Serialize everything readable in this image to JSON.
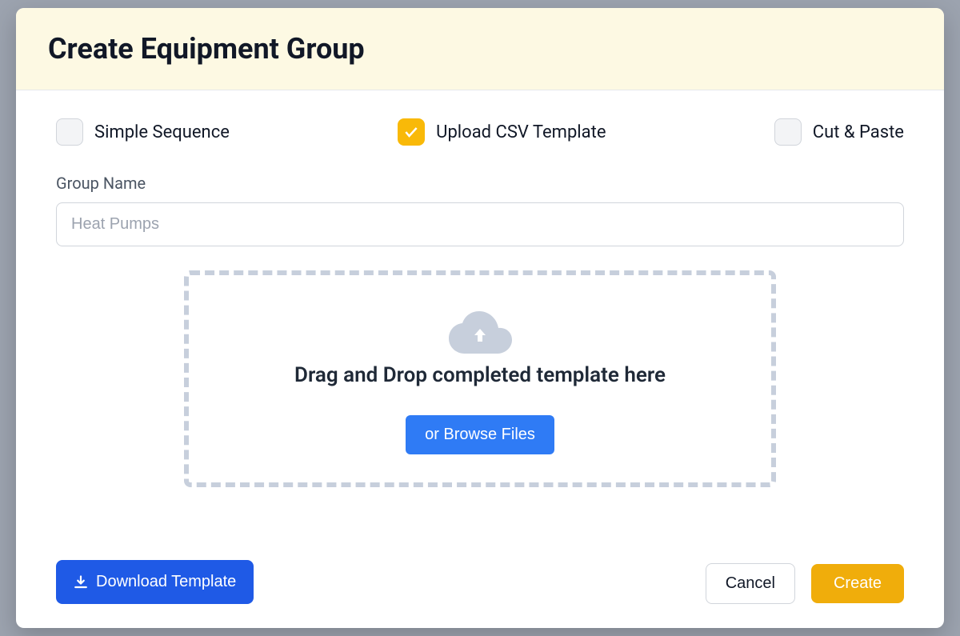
{
  "modal": {
    "title": "Create Equipment Group"
  },
  "options": {
    "simple_sequence": {
      "label": "Simple Sequence",
      "checked": false
    },
    "upload_csv": {
      "label": "Upload CSV Template",
      "checked": true
    },
    "cut_paste": {
      "label": "Cut & Paste",
      "checked": false
    }
  },
  "group_name": {
    "label": "Group Name",
    "placeholder": "Heat Pumps",
    "value": ""
  },
  "dropzone": {
    "text": "Drag and Drop completed template here",
    "browse_label": "or Browse Files"
  },
  "buttons": {
    "download_template": "Download Template",
    "cancel": "Cancel",
    "create": "Create"
  }
}
